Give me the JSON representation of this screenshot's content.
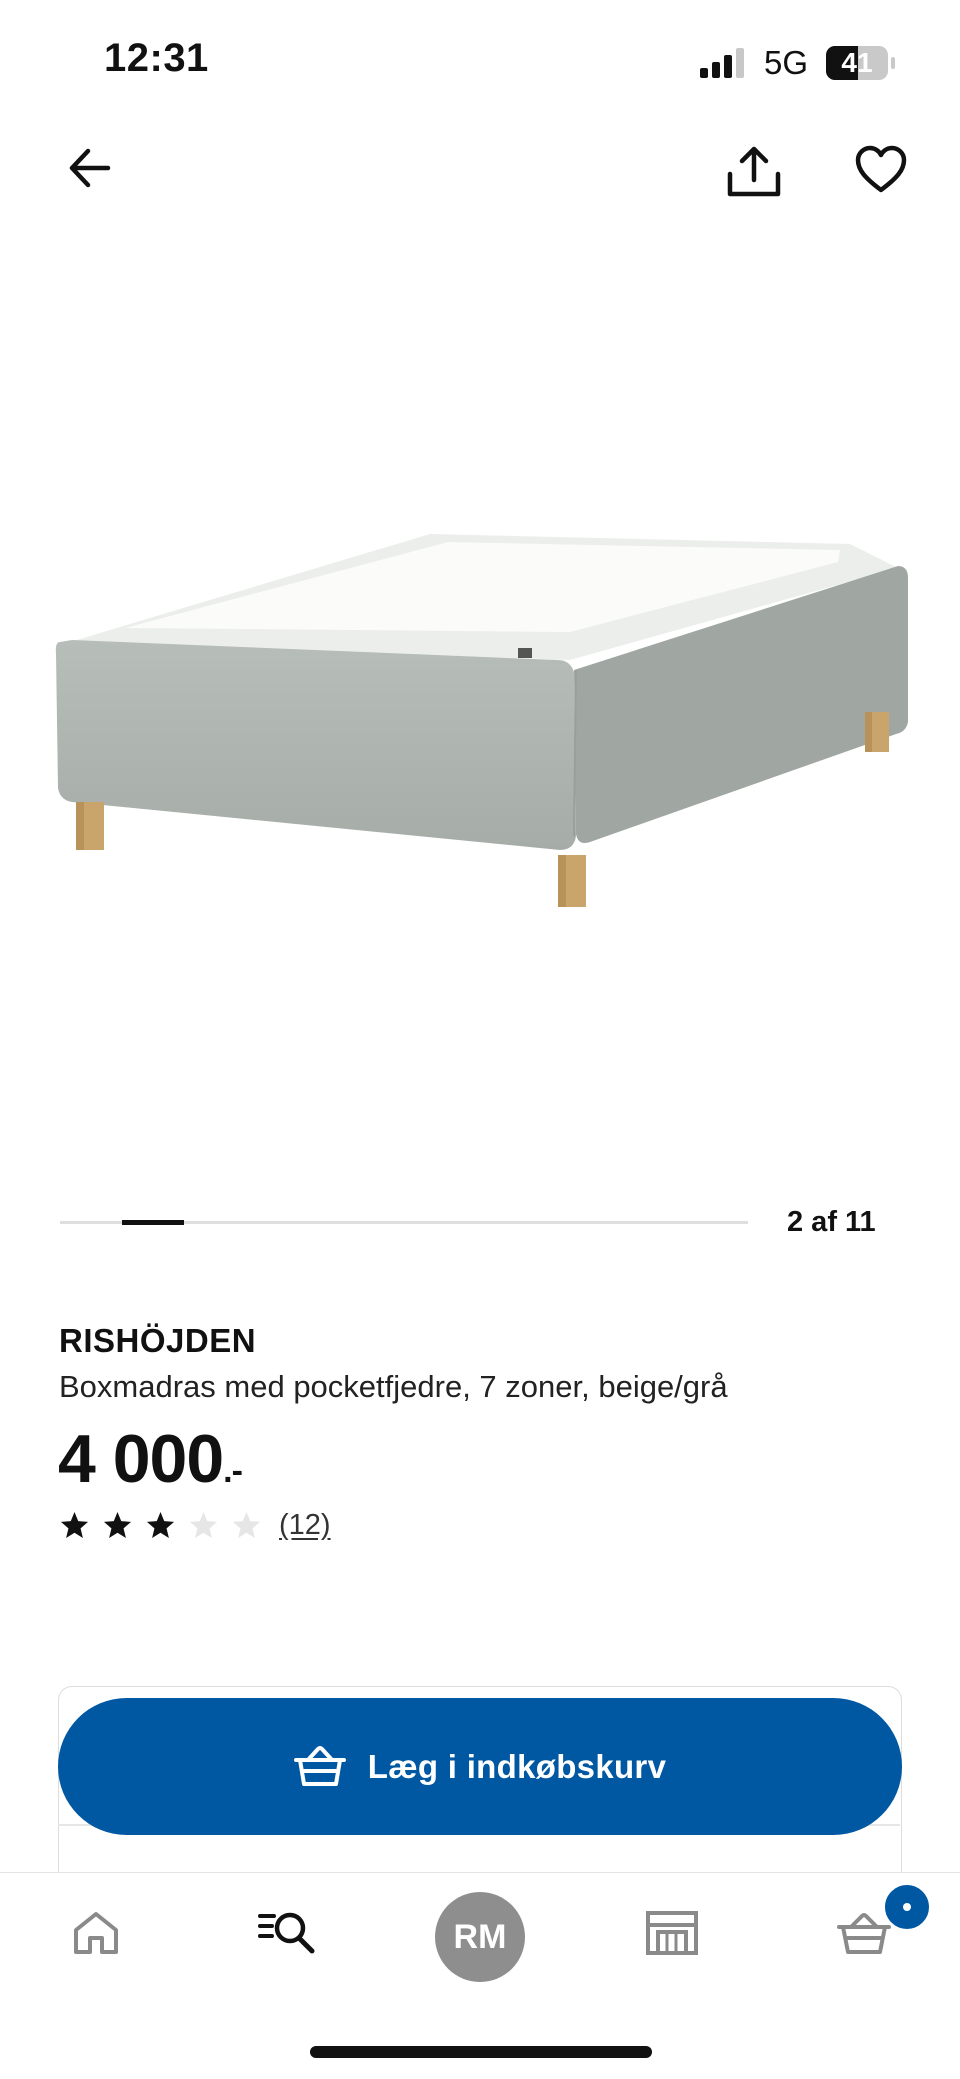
{
  "status_bar": {
    "time": "12:31",
    "network": "5G",
    "battery": "41"
  },
  "nav": {
    "back_icon": "arrow-left-icon",
    "share_icon": "share-icon",
    "favorite_icon": "heart-icon"
  },
  "gallery": {
    "counter": "2 af 11",
    "current_index": 2,
    "total": 11
  },
  "product": {
    "brand": "RISHÖJDEN",
    "description": "Boxmadras med pocketfjedre, 7 zoner, beige/grå",
    "price": "4 000",
    "price_suffix": ".-",
    "rating": 3,
    "rating_max": 5,
    "review_count": "(12)"
  },
  "cta": {
    "label": "Læg i indkøbskurv",
    "icon": "shopping-basket-icon",
    "color": "#0058a3"
  },
  "tab_bar": {
    "avatar_initials": "RM",
    "items": [
      "home-icon",
      "search-list-icon",
      "avatar",
      "store-icon",
      "cart-icon"
    ],
    "badge_color": "#0058a3"
  },
  "colors": {
    "accent": "#0058a3",
    "star_filled": "#111111",
    "star_empty": "#e6e6e6"
  }
}
